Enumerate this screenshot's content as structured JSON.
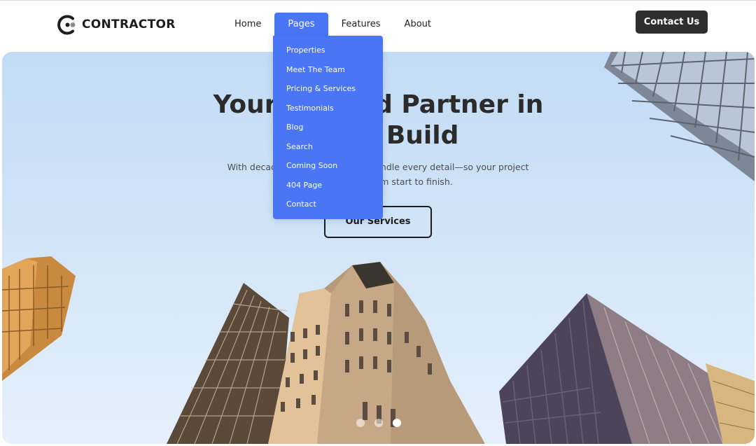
{
  "header": {
    "logo_text": "CONTRACTOR",
    "nav": [
      {
        "label": "Home"
      },
      {
        "label": "Pages"
      },
      {
        "label": "Features"
      },
      {
        "label": "About"
      }
    ],
    "contact_label": "Contact Us"
  },
  "dropdown": {
    "items": [
      {
        "label": "Properties"
      },
      {
        "label": "Meet The Team"
      },
      {
        "label": "Pricing & Services"
      },
      {
        "label": "Testimonials"
      },
      {
        "label": "Blog"
      },
      {
        "label": "Search"
      },
      {
        "label": "Coming Soon"
      },
      {
        "label": "404 Page"
      },
      {
        "label": "Contact"
      }
    ]
  },
  "hero": {
    "title_line1": "Your Trusted Partner in",
    "title_line2": "Every Build",
    "subtitle": "With decades of experience, we handle every detail—so your project runs smoothly from start to finish.",
    "button_label": "Our Services",
    "slides_total": 3,
    "active_slide": 3
  },
  "colors": {
    "accent": "#4a76f6",
    "dark": "#2e2e2e",
    "text": "#1e1e1e"
  },
  "icons": {
    "logo": "contractor-logo-icon"
  }
}
